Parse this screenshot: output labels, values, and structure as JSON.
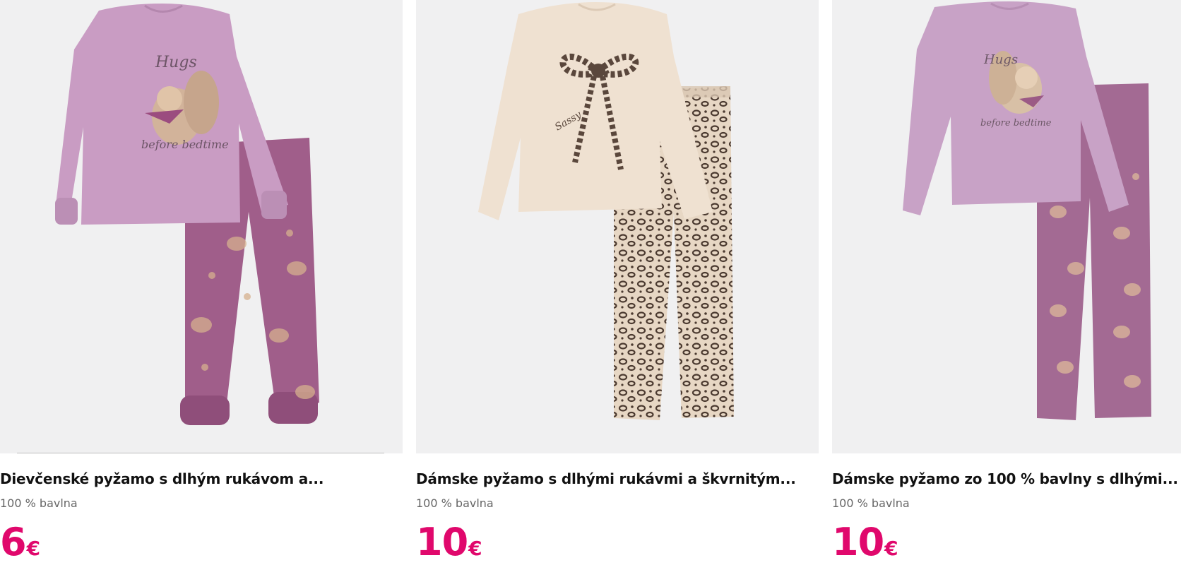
{
  "products": [
    {
      "title": "Dievčenské pyžamo s dlhým rukávom a...",
      "material": "100 % bavlna",
      "price": "6",
      "currency": "€",
      "image_icon": "girls-pajama-squirrel-image",
      "colors": {
        "top": "#c99cc3",
        "pants": "#a05e8a"
      }
    },
    {
      "title": "Dámske pyžamo s dlhými rukávmi a škvrnitým...",
      "material": "100 % bavlna",
      "price": "10",
      "currency": "€",
      "image_icon": "womens-pajama-leopard-bow-image",
      "colors": {
        "top": "#efe1d1",
        "pants": "#d9c7b3"
      }
    },
    {
      "title": "Dámske pyžamo zo 100 % bavlny s dlhými...",
      "material": "100 % bavlna",
      "price": "10",
      "currency": "€",
      "image_icon": "womens-pajama-squirrel-image",
      "colors": {
        "top": "#c8a2c6",
        "pants": "#a36a93"
      }
    }
  ],
  "price_color": "#e0086c",
  "image_background": "#f0f0f1"
}
